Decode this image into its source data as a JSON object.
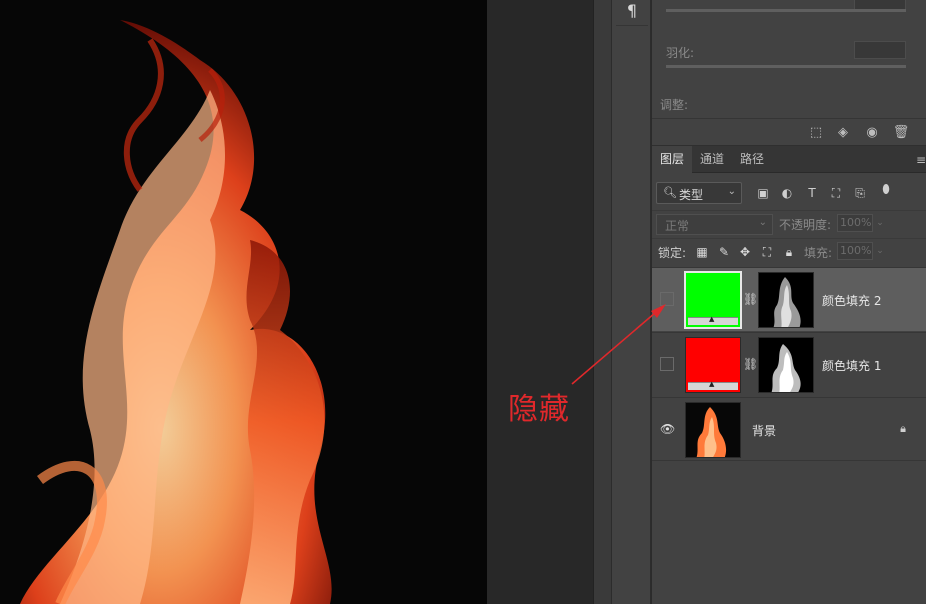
{
  "properties": {
    "feather_label": "羽化:",
    "adjust_label": "调整:"
  },
  "layers_panel": {
    "tabs": [
      "图层",
      "通道",
      "路径"
    ],
    "active_tab": 0,
    "menu_icon": "≡",
    "filter": {
      "label": "类型",
      "icon": "search-icon"
    },
    "blend_mode": "正常",
    "opacity_label": "不透明度:",
    "opacity_value": "100%",
    "lock_label": "锁定:",
    "fill_label": "填充:",
    "fill_value": "100%",
    "layers": [
      {
        "name": "颜色填充 2",
        "visible": false,
        "selected": true,
        "fill_color": "#00ff00",
        "has_mask": true
      },
      {
        "name": "颜色填充 1",
        "visible": false,
        "selected": false,
        "fill_color": "#ff0000",
        "has_mask": true
      },
      {
        "name": "背景",
        "visible": true,
        "selected": false,
        "locked": true
      }
    ]
  },
  "paragraph_icon": "¶",
  "annotation": {
    "text": "隐藏",
    "color": "#e0282b"
  }
}
